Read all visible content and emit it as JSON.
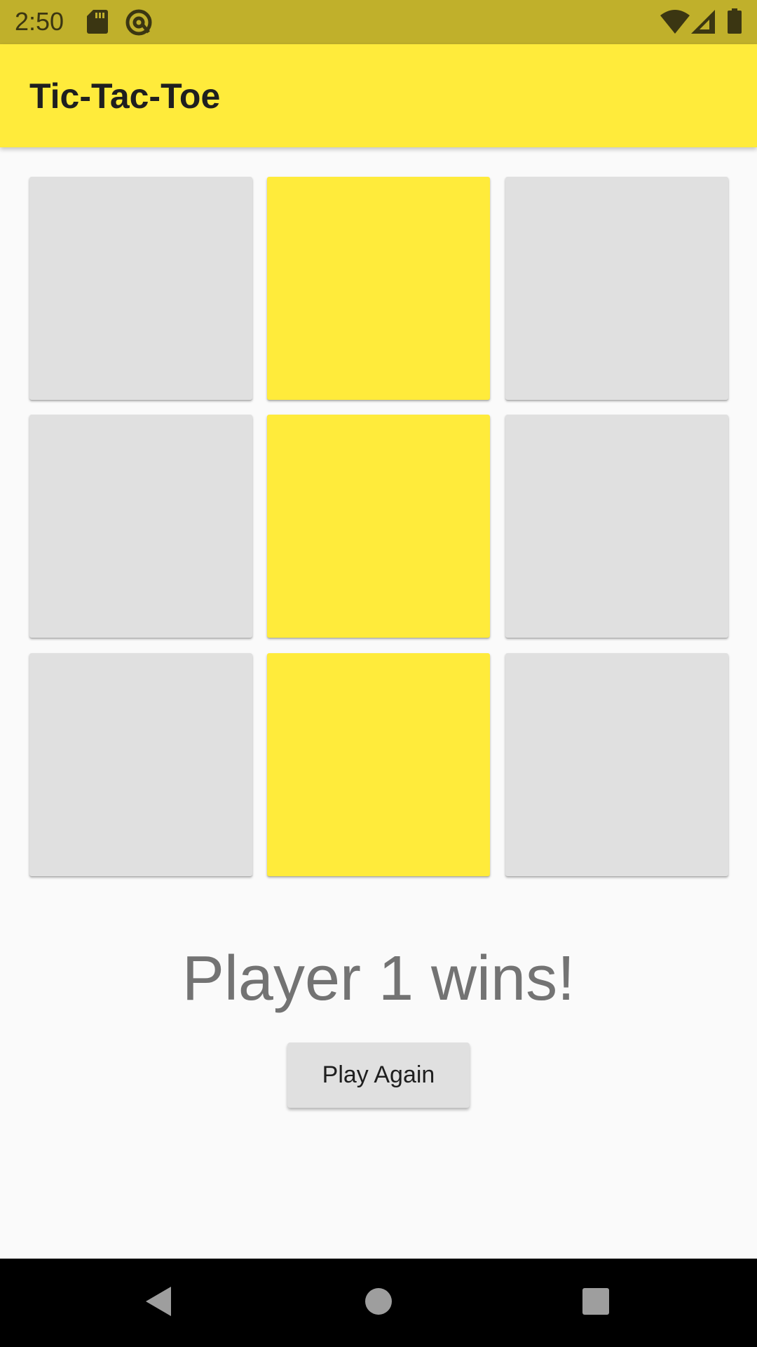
{
  "status_bar": {
    "time": "2:50",
    "left_icons": [
      "sd-card-icon",
      "at-sign-icon"
    ],
    "right_icons": [
      "wifi-icon",
      "signal-icon",
      "battery-icon"
    ],
    "color": "#c0b02b"
  },
  "app_bar": {
    "title": "Tic-Tac-Toe",
    "color": "#ffeb3b"
  },
  "board": {
    "cells": [
      {
        "row": 1,
        "col": 1,
        "state": "empty"
      },
      {
        "row": 1,
        "col": 2,
        "state": "player1"
      },
      {
        "row": 1,
        "col": 3,
        "state": "empty"
      },
      {
        "row": 2,
        "col": 1,
        "state": "empty"
      },
      {
        "row": 2,
        "col": 2,
        "state": "player1"
      },
      {
        "row": 2,
        "col": 3,
        "state": "empty"
      },
      {
        "row": 3,
        "col": 1,
        "state": "empty"
      },
      {
        "row": 3,
        "col": 2,
        "state": "player1"
      },
      {
        "row": 3,
        "col": 3,
        "state": "empty"
      }
    ],
    "empty_color": "#e0e0e0",
    "player1_color": "#ffeb3b"
  },
  "result": {
    "message": "Player 1 wins!"
  },
  "actions": {
    "play_again_label": "Play Again"
  },
  "nav_bar": {
    "icons": [
      "back-icon",
      "home-icon",
      "recents-icon"
    ]
  }
}
